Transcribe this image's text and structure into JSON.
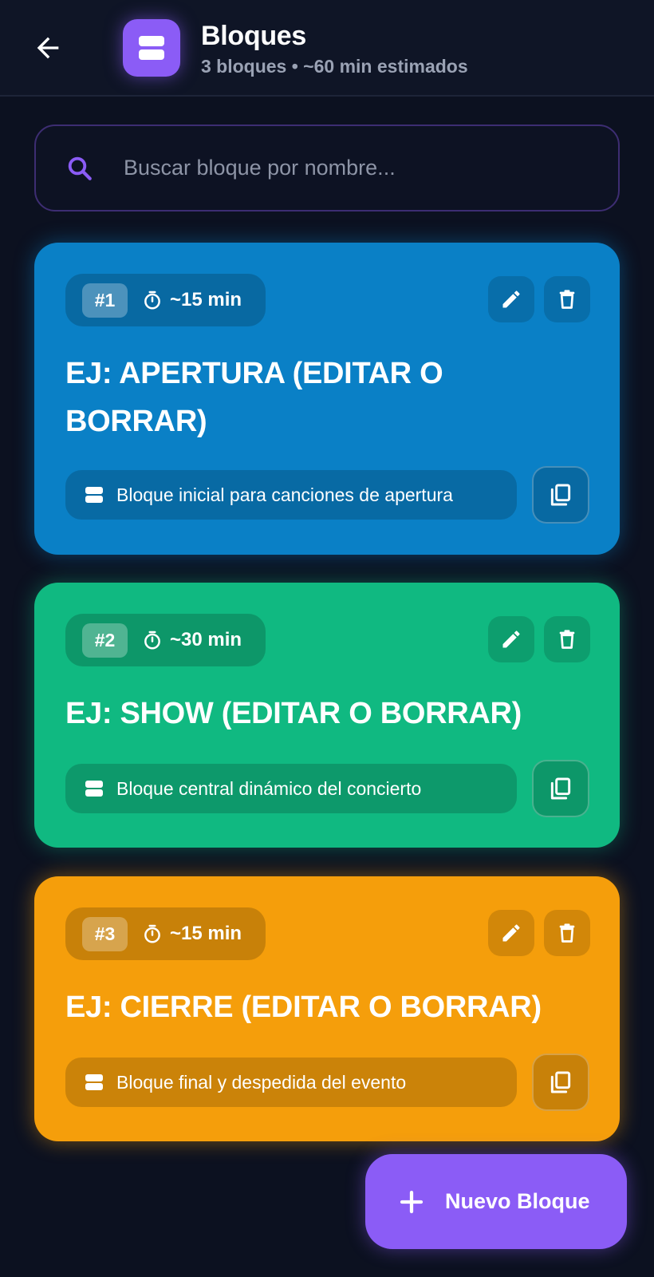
{
  "header": {
    "title": "Bloques",
    "subtitle": "3 bloques • ~60 min estimados",
    "back_icon": "arrow-left-icon",
    "app_icon": "blocks-icon",
    "accent": "#8b5cf6"
  },
  "search": {
    "placeholder": "Buscar bloque por nombre...",
    "value": "",
    "icon": "search-icon"
  },
  "blocks": [
    {
      "number": "#1",
      "duration": "~15 min",
      "title": "EJ:  APERTURA (EDITAR O BORRAR)",
      "description": "Bloque inicial para canciones de apertura",
      "color": "#0a80c6"
    },
    {
      "number": "#2",
      "duration": "~30 min",
      "title": "EJ:  SHOW (EDITAR O BORRAR)",
      "description": "Bloque central dinámico del concierto",
      "color": "#10b981"
    },
    {
      "number": "#3",
      "duration": "~15 min",
      "title": "EJ:  CIERRE (EDITAR O BORRAR)",
      "description": "Bloque final y despedida del evento",
      "color": "#f59e0b"
    }
  ],
  "fab": {
    "label": "Nuevo Bloque",
    "icon": "plus-icon"
  }
}
